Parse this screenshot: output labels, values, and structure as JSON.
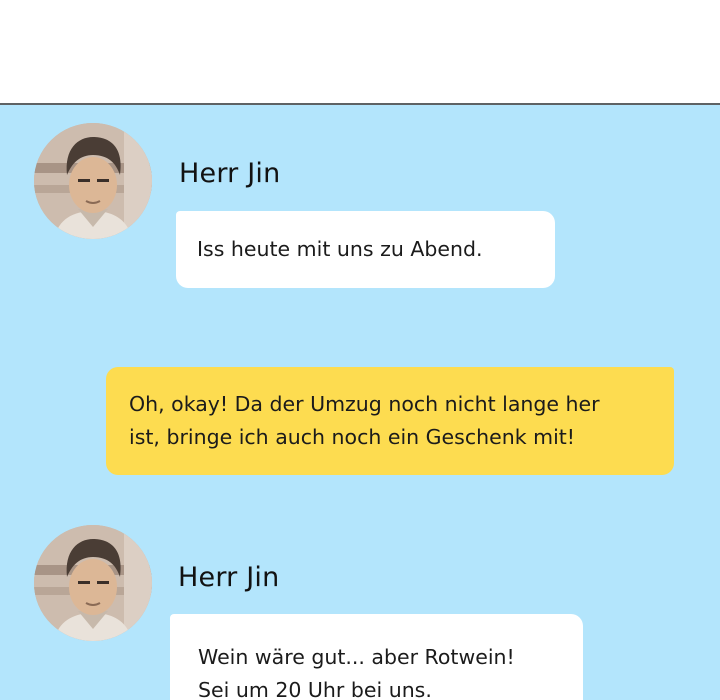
{
  "chat": {
    "messages": [
      {
        "sender": "Herr Jin",
        "avatar_icon": "person-avatar-icon",
        "lines": [
          "Iss heute mit uns zu Abend."
        ]
      },
      {
        "sender": "",
        "lines": [
          "Oh, okay! Da der Umzug noch nicht lange her",
          "ist, bringe ich auch noch ein Geschenk mit!"
        ]
      },
      {
        "sender": "Herr Jin",
        "avatar_icon": "person-avatar-icon",
        "lines": [
          "Wein wäre gut... aber Rotwein!",
          "Sei um 20 Uhr bei uns."
        ]
      }
    ]
  },
  "colors": {
    "chat_background": "#b3e5fc",
    "incoming_bubble": "#ffffff",
    "outgoing_bubble": "#fddc50",
    "divider": "#5e6264"
  }
}
